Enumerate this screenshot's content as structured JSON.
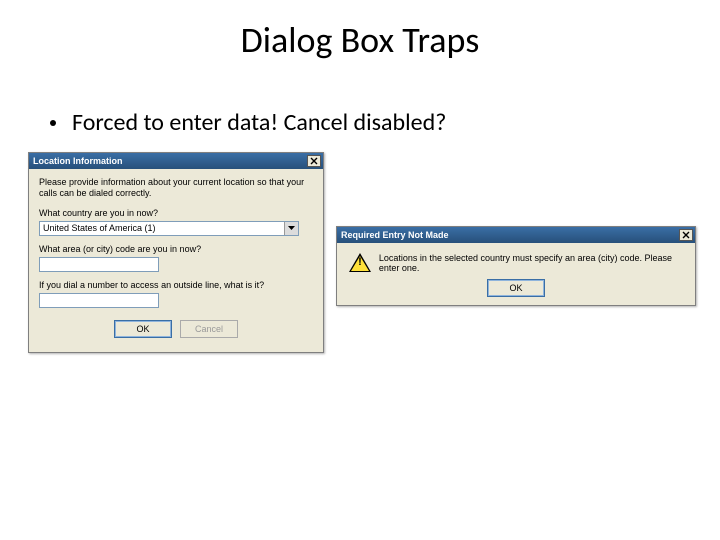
{
  "slide": {
    "title": "Dialog Box Traps",
    "bullet": "Forced to enter data!  Cancel disabled?"
  },
  "dialog1": {
    "title": "Location Information",
    "intro": "Please provide information about your current location so that your calls can be dialed correctly.",
    "q_country": "What country are you in now?",
    "country_value": "United States of America (1)",
    "q_areacode": "What area (or city) code are you in now?",
    "areacode_value": "",
    "q_outside": "If you dial a number to access an outside line, what is it?",
    "outside_value": "",
    "ok": "OK",
    "cancel": "Cancel"
  },
  "dialog2": {
    "title": "Required Entry Not Made",
    "message": "Locations in the selected country must specify an area (city) code.  Please enter one.",
    "ok": "OK"
  }
}
